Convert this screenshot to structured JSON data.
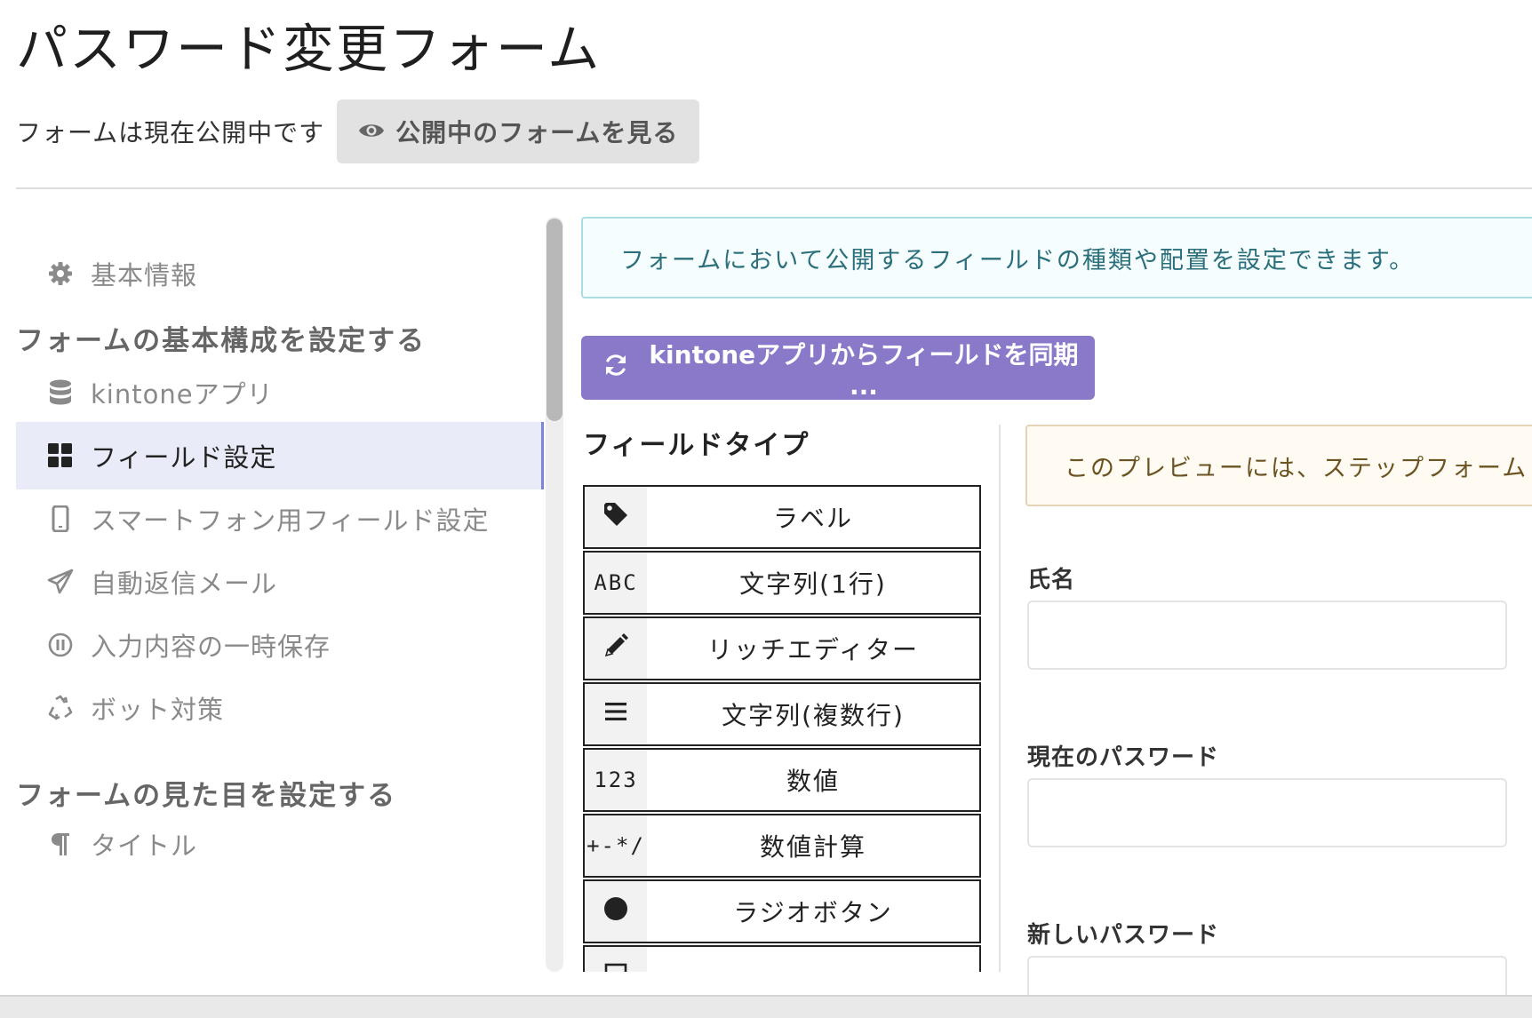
{
  "page": {
    "title": "パスワード変更フォーム"
  },
  "status": {
    "text": "フォームは現在公開中です",
    "view_button": "公開中のフォームを見る"
  },
  "sidebar": {
    "basic_info": "基本情報",
    "section1": "フォームの基本構成を設定する",
    "items1": [
      {
        "label": "kintoneアプリ",
        "icon": "database-icon"
      },
      {
        "label": "フィールド設定",
        "icon": "grid-icon",
        "active": true
      },
      {
        "label": "スマートフォン用フィールド設定",
        "icon": "smartphone-icon"
      },
      {
        "label": "自動返信メール",
        "icon": "paper-plane-icon"
      },
      {
        "label": "入力内容の一時保存",
        "icon": "pause-circle-icon"
      },
      {
        "label": "ボット対策",
        "icon": "recycle-icon"
      }
    ],
    "section2": "フォームの見た目を設定する",
    "items2": [
      {
        "label": "タイトル",
        "icon": "paragraph-icon"
      }
    ]
  },
  "main": {
    "info_text": "フォームにおいて公開するフィールドの種類や配置を設定できます。",
    "sync_button": "kintoneアプリからフィールドを同期 ...",
    "field_type_heading": "フィールドタイプ",
    "field_types": [
      {
        "badge": "",
        "icon": "tag-icon",
        "label": "ラベル"
      },
      {
        "badge": "ABC",
        "icon": "",
        "label": "文字列(1行)"
      },
      {
        "badge": "",
        "icon": "pencil-icon",
        "label": "リッチエディター"
      },
      {
        "badge": "",
        "icon": "list-lines-icon",
        "label": "文字列(複数行)"
      },
      {
        "badge": "123",
        "icon": "",
        "label": "数値"
      },
      {
        "badge": "+-*/",
        "icon": "",
        "label": "数値計算"
      },
      {
        "badge": "",
        "icon": "radio-dot-icon",
        "label": "ラジオボタン"
      }
    ],
    "preview_text": "このプレビューには、ステップフォーム",
    "form_fields": [
      "氏名",
      "現在のパスワード",
      "新しいパスワード"
    ]
  }
}
